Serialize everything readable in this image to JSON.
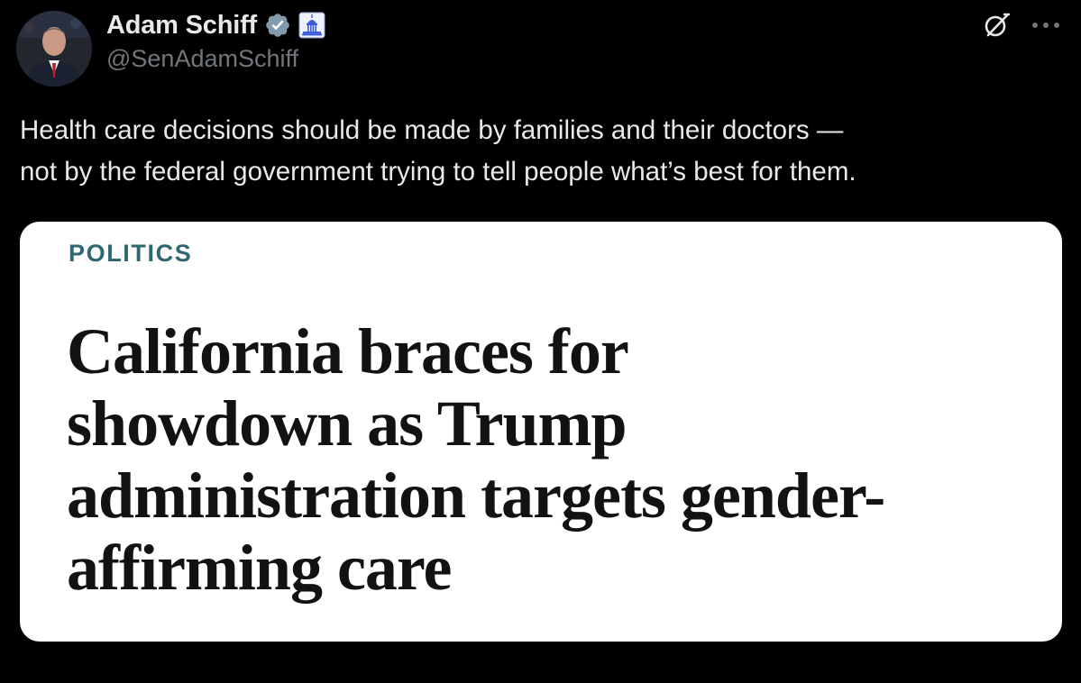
{
  "author": {
    "display_name": "Adam Schiff",
    "handle": "@SenAdamSchiff",
    "avatar_icon": "profile-photo",
    "badges": [
      "verified-checkmark-icon",
      "government-capitol-badge-icon"
    ]
  },
  "actions": {
    "grok_icon": "grok-icon",
    "more_icon": "more-options-icon"
  },
  "tweet": {
    "text_line_1": "Health care decisions should be made by families and their doctors —",
    "text_line_2": "not by the federal government trying to tell people what’s best for them."
  },
  "card": {
    "kicker": "POLITICS",
    "headline_lines": [
      "California braces for",
      "showdown as Trump",
      "administration targets gender-",
      "affirming care"
    ]
  },
  "colors": {
    "background": "#000000",
    "text_primary": "#e7e9ea",
    "text_secondary": "#71767b",
    "verified_badge": "#829aab",
    "gov_badge": "#3b5bdb",
    "card_background": "#ffffff",
    "kicker": "#2f6770",
    "headline": "#121212"
  }
}
